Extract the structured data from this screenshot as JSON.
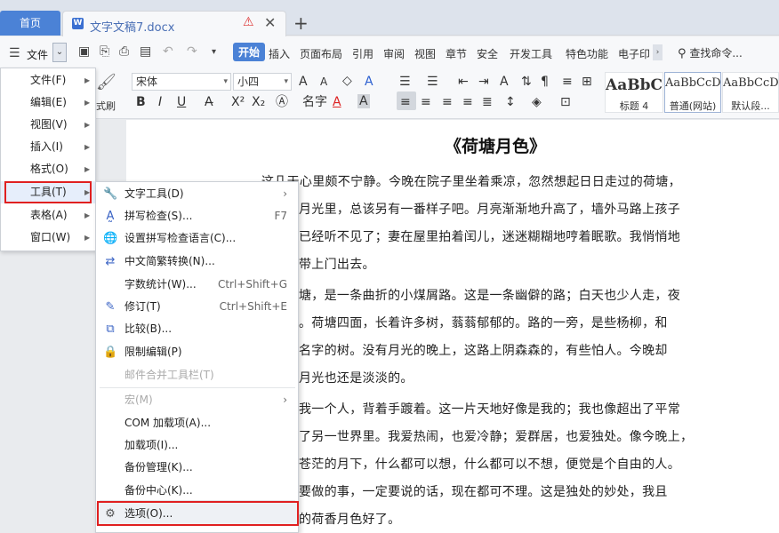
{
  "tabs": {
    "home": "首页",
    "doc_title": "文字文稿7.docx",
    "doc_icon": "W",
    "add": "+"
  },
  "menubar": {
    "file_label": "文件",
    "tabs": [
      "开始",
      "插入",
      "页面布局",
      "引用",
      "审阅",
      "视图",
      "章节",
      "安全",
      "开发工具",
      "特色功能",
      "电子印"
    ],
    "more": "›",
    "search": "查找命令..."
  },
  "ribbon": {
    "font": "宋体",
    "size": "小四",
    "format_painter_label": "式刷",
    "styles": [
      {
        "sample": "AaBbC",
        "label": "标题 4"
      },
      {
        "sample": "AaBbCcDd",
        "label": "普通(网站)"
      },
      {
        "sample": "AaBbCcDd",
        "label": "默认段..."
      }
    ],
    "bold": "B",
    "italic": "I",
    "underline": "U",
    "font_a": "A",
    "grow": "A",
    "shrink": "A"
  },
  "menu1": {
    "items": [
      {
        "label": "文件(F)"
      },
      {
        "label": "编辑(E)"
      },
      {
        "label": "视图(V)"
      },
      {
        "label": "插入(I)"
      },
      {
        "label": "格式(O)"
      },
      {
        "label": "工具(T)"
      },
      {
        "label": "表格(A)"
      },
      {
        "label": "窗口(W)"
      }
    ]
  },
  "menu2": {
    "items": [
      {
        "icon": "text-tools-icon",
        "label": "文字工具(D)",
        "shortcut": "",
        "arrow": "›"
      },
      {
        "icon": "spellcheck-icon",
        "label": "拼写检查(S)...",
        "shortcut": "F7"
      },
      {
        "icon": "globe-icon",
        "label": "设置拼写检查语言(C)...",
        "shortcut": ""
      },
      {
        "icon": "convert-icon",
        "label": "中文简繁转换(N)...",
        "shortcut": ""
      },
      {
        "icon": "",
        "label": "字数统计(W)...",
        "shortcut": "Ctrl+Shift+G"
      },
      {
        "icon": "track-changes-icon",
        "label": "修订(T)",
        "shortcut": "Ctrl+Shift+E"
      },
      {
        "icon": "compare-icon",
        "label": "比较(B)...",
        "shortcut": ""
      },
      {
        "icon": "restrict-edit-icon",
        "label": "限制编辑(P)",
        "shortcut": ""
      },
      {
        "icon": "",
        "label": "邮件合并工具栏(T)",
        "shortcut": "",
        "disabled": true
      },
      {
        "icon": "",
        "label": "宏(M)",
        "shortcut": "",
        "disabled": true,
        "arrow": "›"
      },
      {
        "icon": "",
        "label": "COM 加载项(A)...",
        "shortcut": ""
      },
      {
        "icon": "",
        "label": "加载项(I)...",
        "shortcut": ""
      },
      {
        "icon": "",
        "label": "备份管理(K)...",
        "shortcut": ""
      },
      {
        "icon": "",
        "label": "备份中心(K)...",
        "shortcut": ""
      },
      {
        "icon": "gear-icon",
        "label": "选项(O)...",
        "shortcut": ""
      }
    ]
  },
  "document": {
    "title": "《荷塘月色》",
    "lines": [
      "这几天心里颇不宁静。今晚在院子里坐着乘凉，忽然想起日日走过的荷塘，",
      "月光里，总该另有一番样子吧。月亮渐渐地升高了，墙外马路上孩子",
      "已经听不见了；妻在屋里拍着闰儿，迷迷糊糊地哼着眠歌。我悄悄地",
      "带上门出去。",
      "塘，是一条曲折的小煤屑路。这是一条幽僻的路；白天也少人走，夜",
      "。荷塘四面，长着许多树，蓊蓊郁郁的。路的一旁，是些杨柳，和",
      "名字的树。没有月光的晚上，这路上阴森森的，有些怕人。今晚却",
      "月光也还是淡淡的。",
      "我一个人，背着手踱着。这一片天地好像是我的；我也像超出了平常",
      "了另一世界里。我爱热闹，也爱冷静；爱群居，也爱独处。像今晚上，",
      "苍茫的月下，什么都可以想，什么都可以不想，便觉是个自由的人。",
      "要做的事，一定要说的话，现在都可不理。这是独处的妙处，我且",
      "的荷香月色好了。"
    ]
  }
}
